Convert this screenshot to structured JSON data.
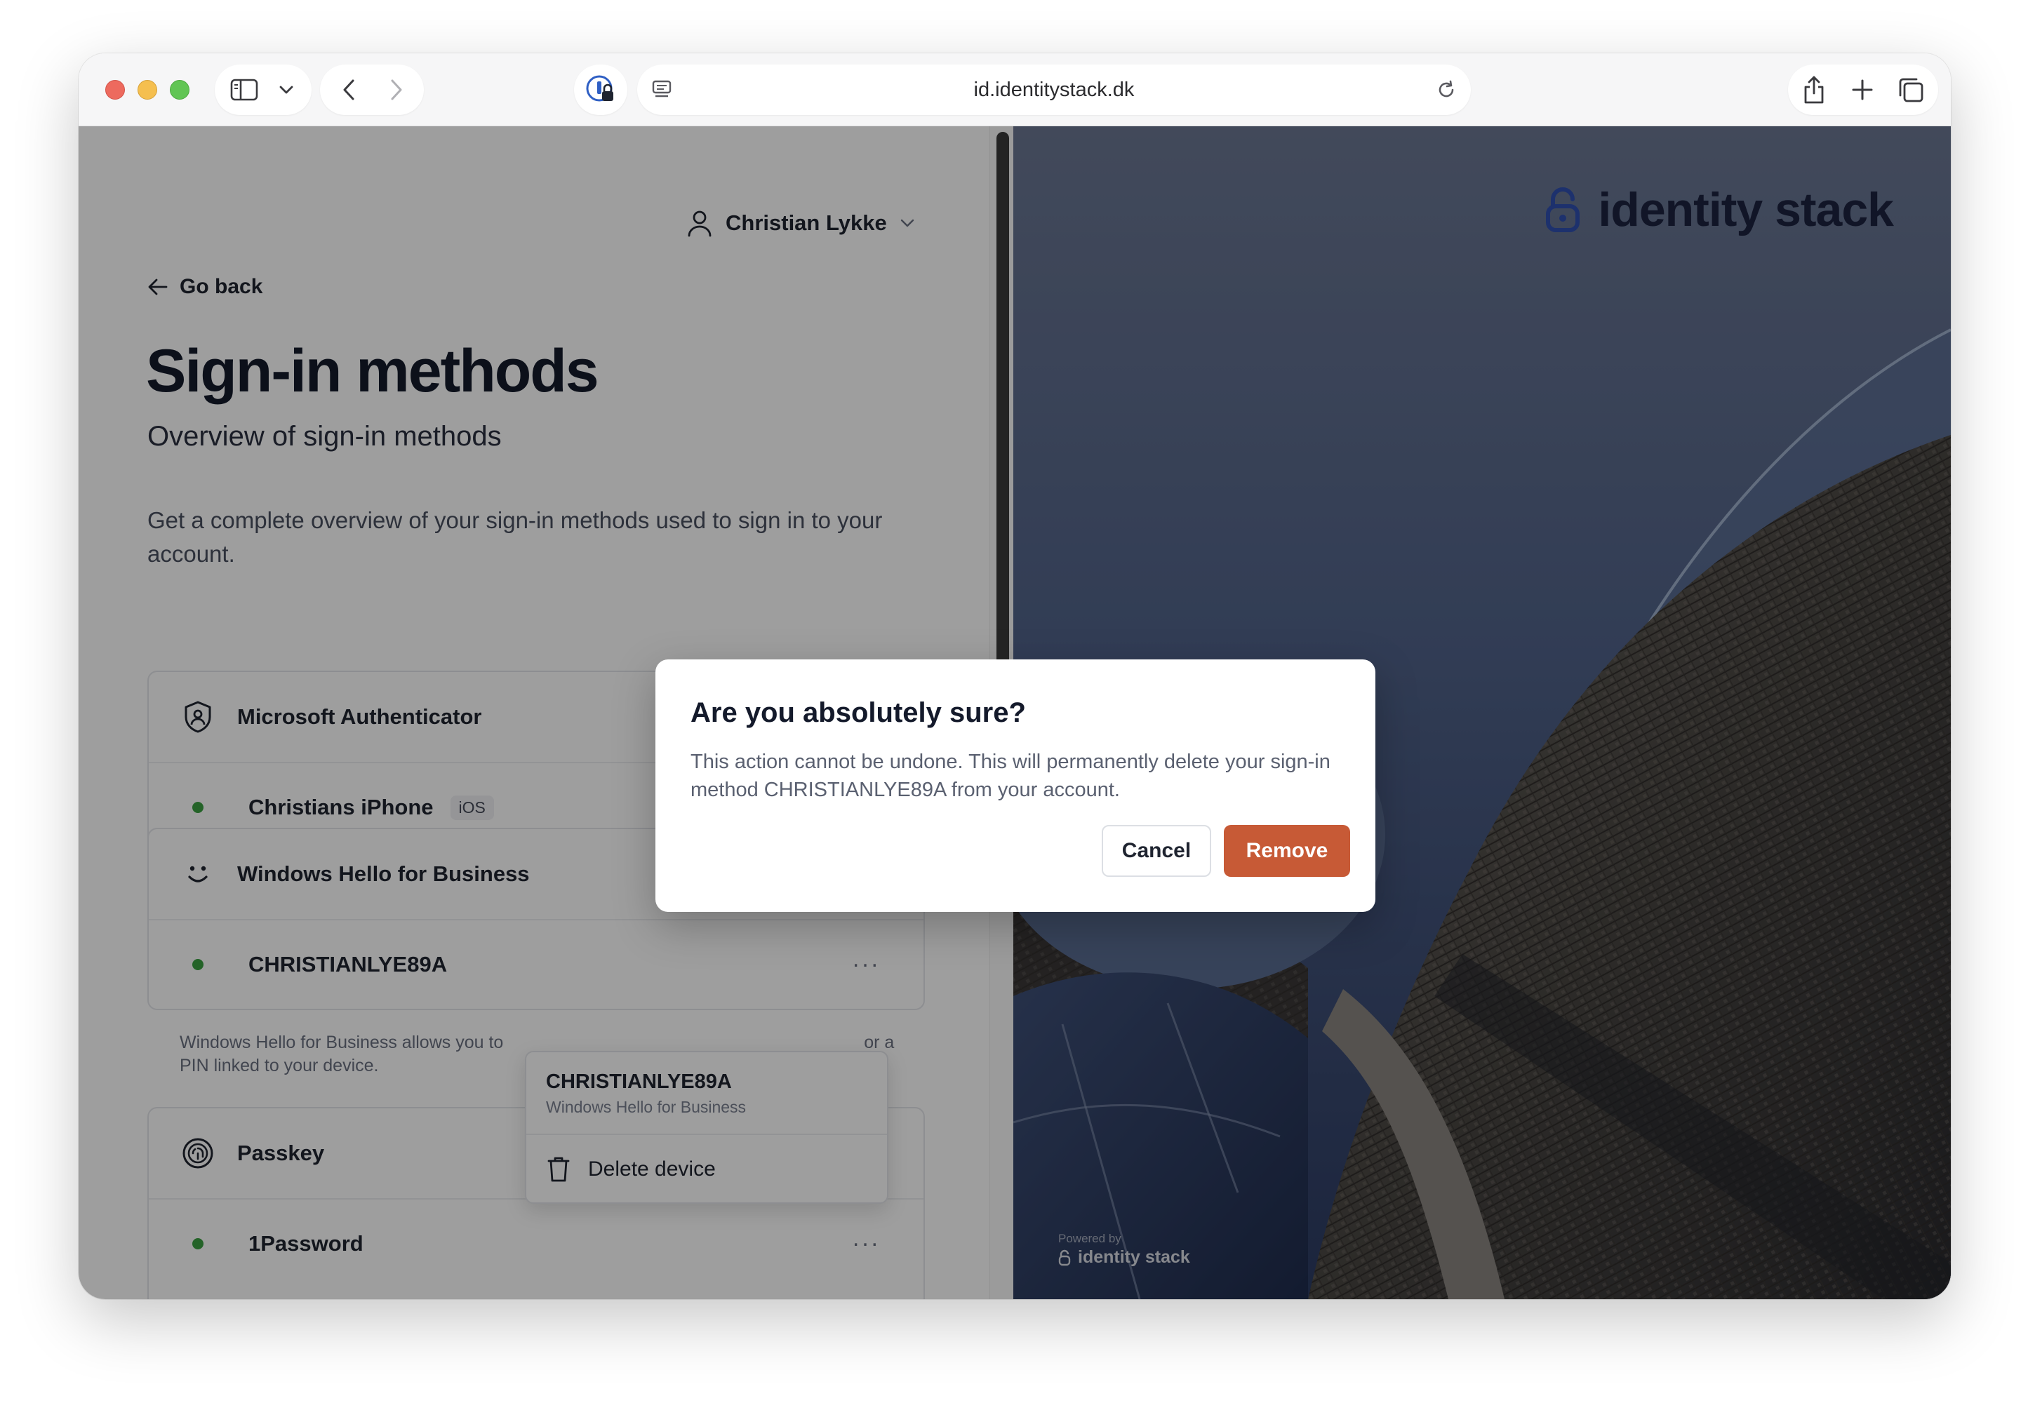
{
  "browser": {
    "url": "id.identitystack.dk"
  },
  "user": {
    "name": "Christian Lykke"
  },
  "nav": {
    "go_back": "Go back"
  },
  "page": {
    "title": "Sign-in methods",
    "subtitle": "Overview of sign-in methods",
    "description": "Get a complete overview of your sign-in methods used to sign in to your account."
  },
  "methods": [
    {
      "name": "Microsoft Authenticator",
      "icon": "authenticator-icon",
      "devices": [
        {
          "name": "Christians iPhone",
          "badge": "iOS"
        }
      ]
    },
    {
      "name": "Windows Hello for Business",
      "icon": "windows-hello-icon",
      "devices": [
        {
          "name": "CHRISTIANLYE89A"
        }
      ],
      "note_start": "Windows Hello for Business allows you to",
      "note_end": "or a",
      "note_line2": "PIN linked to your device."
    },
    {
      "name": "Passkey",
      "icon": "passkey-icon",
      "devices": [
        {
          "name": "1Password"
        }
      ]
    }
  ],
  "context_menu": {
    "title": "CHRISTIANLYE89A",
    "subtitle": "Windows Hello for Business",
    "item": "Delete device"
  },
  "dialog": {
    "title": "Are you absolutely sure?",
    "description": "This action cannot be undone. This will permanently delete your sign-in method CHRISTIANLYE89A from your account.",
    "cancel": "Cancel",
    "confirm": "Remove"
  },
  "brand": {
    "name": "identity stack",
    "powered_by": "Powered by",
    "powered_name": "identity stack"
  },
  "colors": {
    "accent": "#c75a36",
    "brand": "#2f4fb0",
    "status_active": "#3aa142"
  }
}
